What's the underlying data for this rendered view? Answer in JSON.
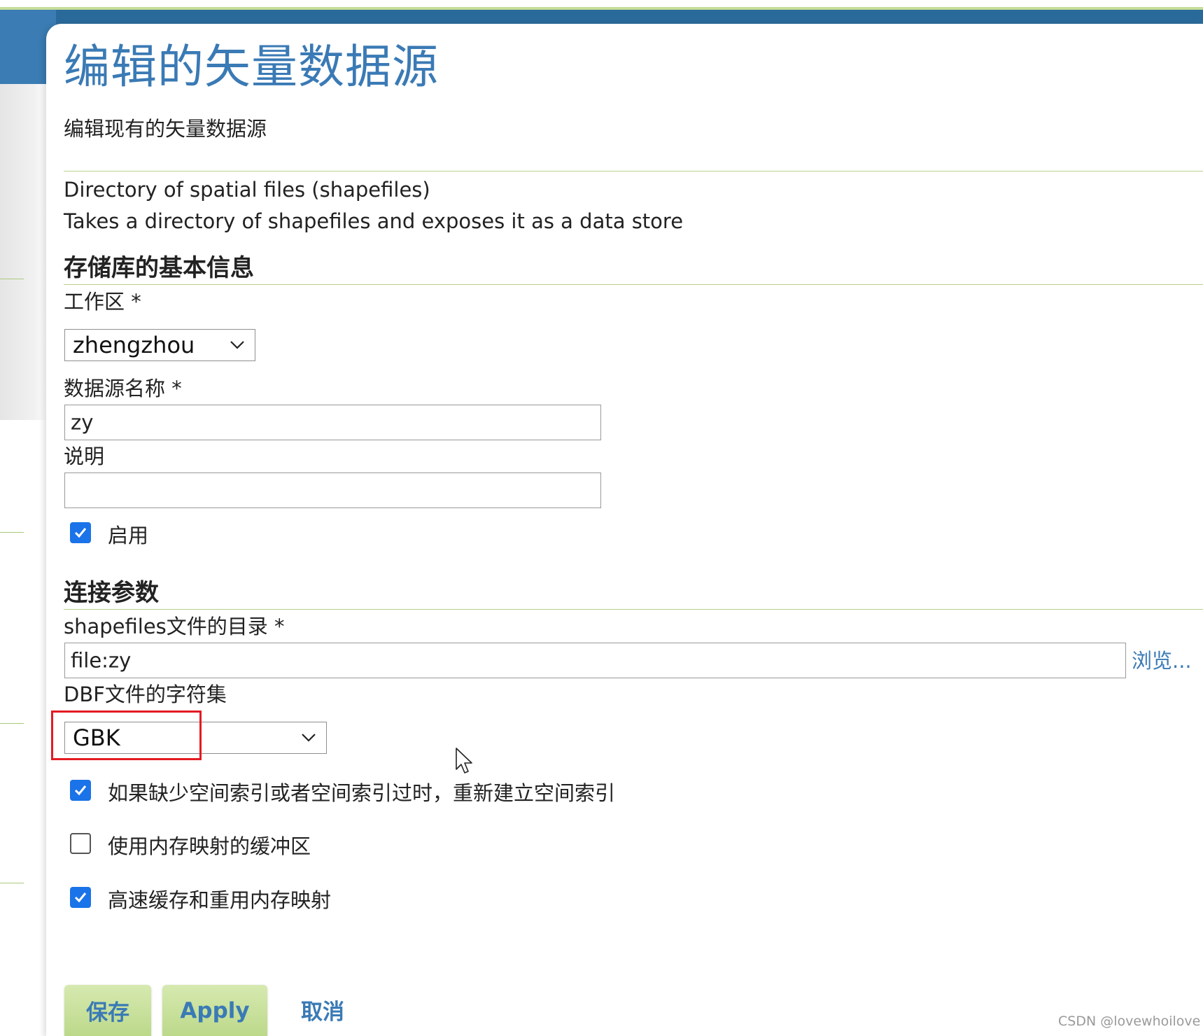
{
  "page": {
    "title": "编辑的矢量数据源",
    "description": "编辑现有的矢量数据源"
  },
  "store_type": {
    "name": "Directory of spatial files (shapefiles)",
    "description": "Takes a directory of shapefiles and exposes it as a data store"
  },
  "basic_info": {
    "heading": "存储库的基本信息",
    "workspace_label": "工作区 *",
    "workspace_value": "zhengzhou",
    "name_label": "数据源名称 *",
    "name_value": "zy",
    "description_label": "说明",
    "description_value": "",
    "enabled_label": "启用",
    "enabled": true
  },
  "connection": {
    "heading": "连接参数",
    "directory_label": "shapefiles文件的目录 *",
    "directory_value": "file:zy",
    "browse_label": "浏览...",
    "charset_label": "DBF文件的字符集",
    "charset_value": "GBK",
    "options": [
      {
        "label": "如果缺少空间索引或者空间索引过时，重新建立空间索引",
        "checked": true
      },
      {
        "label": "使用内存映射的缓冲区",
        "checked": false
      },
      {
        "label": "高速缓存和重用内存映射",
        "checked": true
      }
    ]
  },
  "actions": {
    "save_label": "保存",
    "apply_label": "Apply",
    "cancel_label": "取消"
  },
  "watermark": "CSDN @lovewhoilove",
  "colors": {
    "accent": "#3a7ab5",
    "rule": "#b9d18a",
    "button": "#c9e09e",
    "highlight": "#e31b23",
    "checkbox": "#1a73e8"
  }
}
